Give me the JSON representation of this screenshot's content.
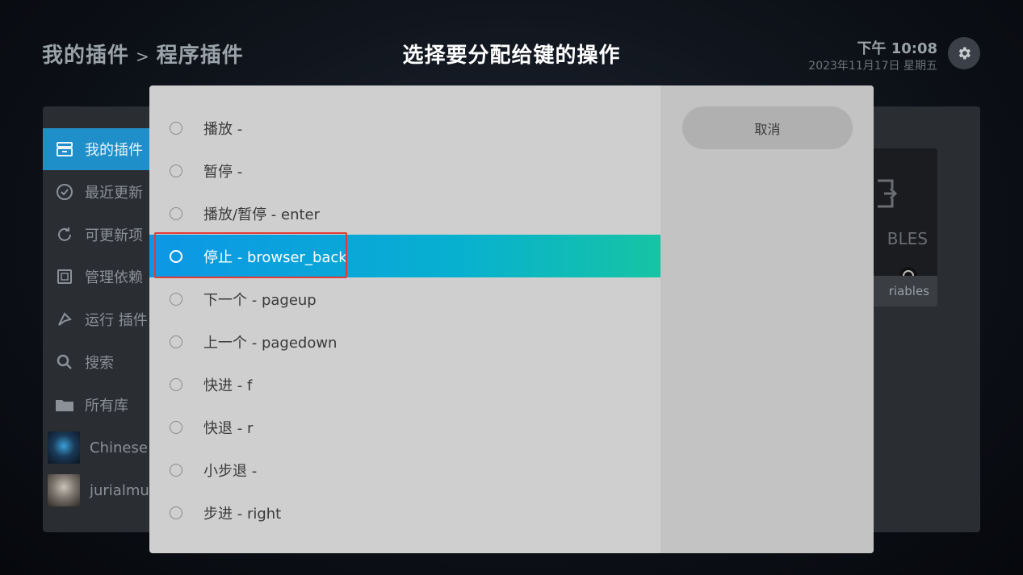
{
  "header": {
    "breadcrumb_root": "我的插件",
    "breadcrumb_sep": ">",
    "breadcrumb_current": "程序插件",
    "dialog_title": "选择要分配给键的操作",
    "time": "下午 10:08",
    "date": "2023年11月17日 星期五"
  },
  "sidebar": {
    "items": [
      {
        "label": "我的插件",
        "icon": "addon-box-icon",
        "active": true
      },
      {
        "label": "最近更新",
        "icon": "recent-update-icon"
      },
      {
        "label": "可更新项",
        "icon": "update-refresh-icon"
      },
      {
        "label": "管理依赖",
        "icon": "dependencies-icon"
      },
      {
        "label": "运行 插件",
        "icon": "run-addon-icon"
      },
      {
        "label": "搜索",
        "icon": "search-icon"
      },
      {
        "label": "所有库",
        "icon": "folder-icon"
      },
      {
        "label": "Chinese A",
        "icon": "addon-thumbnail"
      },
      {
        "label": "jurialmunk",
        "icon": "user-thumbnail"
      }
    ]
  },
  "background_card": {
    "art_text": "BLES",
    "caption": "riables"
  },
  "dialog": {
    "options": [
      {
        "label": "播放 -"
      },
      {
        "label": "暂停 -"
      },
      {
        "label": "播放/暂停 - enter"
      },
      {
        "label": "停止 - browser_back",
        "focused": true
      },
      {
        "label": "下一个 - pageup"
      },
      {
        "label": "上一个 - pagedown"
      },
      {
        "label": "快进 - f"
      },
      {
        "label": "快退 - r"
      },
      {
        "label": "小步退 -"
      },
      {
        "label": "步进 - right"
      }
    ],
    "cancel_label": "取消"
  },
  "colors": {
    "focus_start": "#0c97e6",
    "focus_end": "#16c4a4",
    "annotation": "#e53935",
    "sidebar_active": "#1f8fc9"
  }
}
